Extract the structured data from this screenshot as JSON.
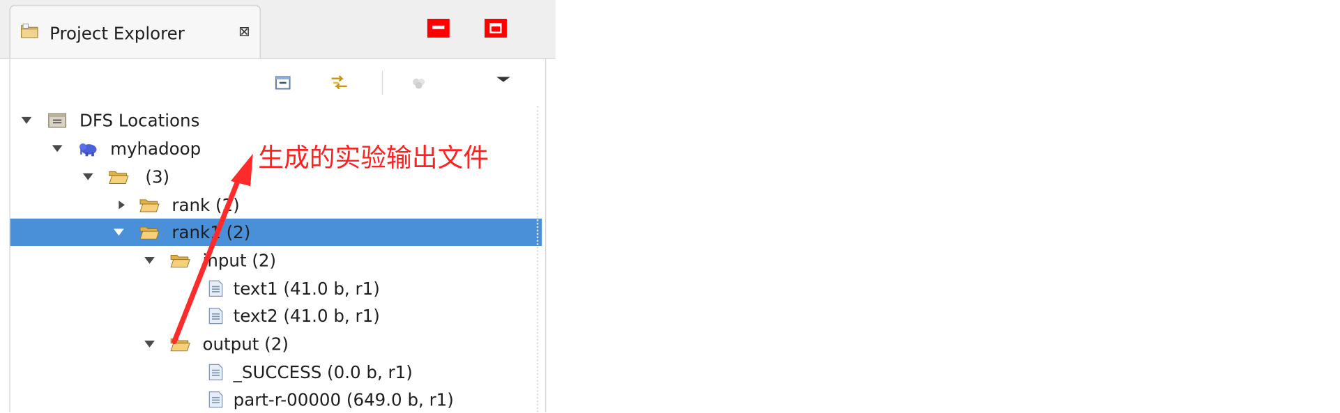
{
  "view": {
    "title": "Project Explorer",
    "close_glyph": "⊠"
  },
  "window_buttons": [
    "minimize",
    "maximize"
  ],
  "toolbar": {
    "items": [
      "collapse-all-icon",
      "link-with-editor-icon",
      "filters-icon",
      "view-menu-icon"
    ]
  },
  "tree": {
    "root": {
      "label": "DFS Locations",
      "icon": "dfs-locations-icon",
      "expanded": true
    },
    "host": {
      "label": "myhadoop",
      "icon": "hadoop-elephant-icon",
      "expanded": true
    },
    "folder_root": {
      "label": "(3)",
      "icon": "folder-open-icon",
      "expanded": true
    },
    "rank": {
      "label": "rank (2)",
      "icon": "folder-open-icon",
      "expanded": false
    },
    "rank1": {
      "label": "rank1 (2)",
      "icon": "folder-open-icon",
      "expanded": true,
      "selected": true
    },
    "input": {
      "label": "input (2)",
      "icon": "folder-open-icon",
      "expanded": true
    },
    "text1": {
      "label": "text1 (41.0 b, r1)",
      "icon": "file-icon"
    },
    "text2": {
      "label": "text2 (41.0 b, r1)",
      "icon": "file-icon"
    },
    "output": {
      "label": "output (2)",
      "icon": "folder-open-icon",
      "expanded": true
    },
    "success": {
      "label": "_SUCCESS (0.0 b, r1)",
      "icon": "file-icon"
    },
    "part": {
      "label": "part-r-00000 (649.0 b, r1)",
      "icon": "file-icon"
    }
  },
  "annotation": {
    "text": "生成的实验输出文件",
    "color": "#ff2020"
  },
  "colors": {
    "selection": "#4a90d9",
    "window_button": "#ff0000"
  }
}
